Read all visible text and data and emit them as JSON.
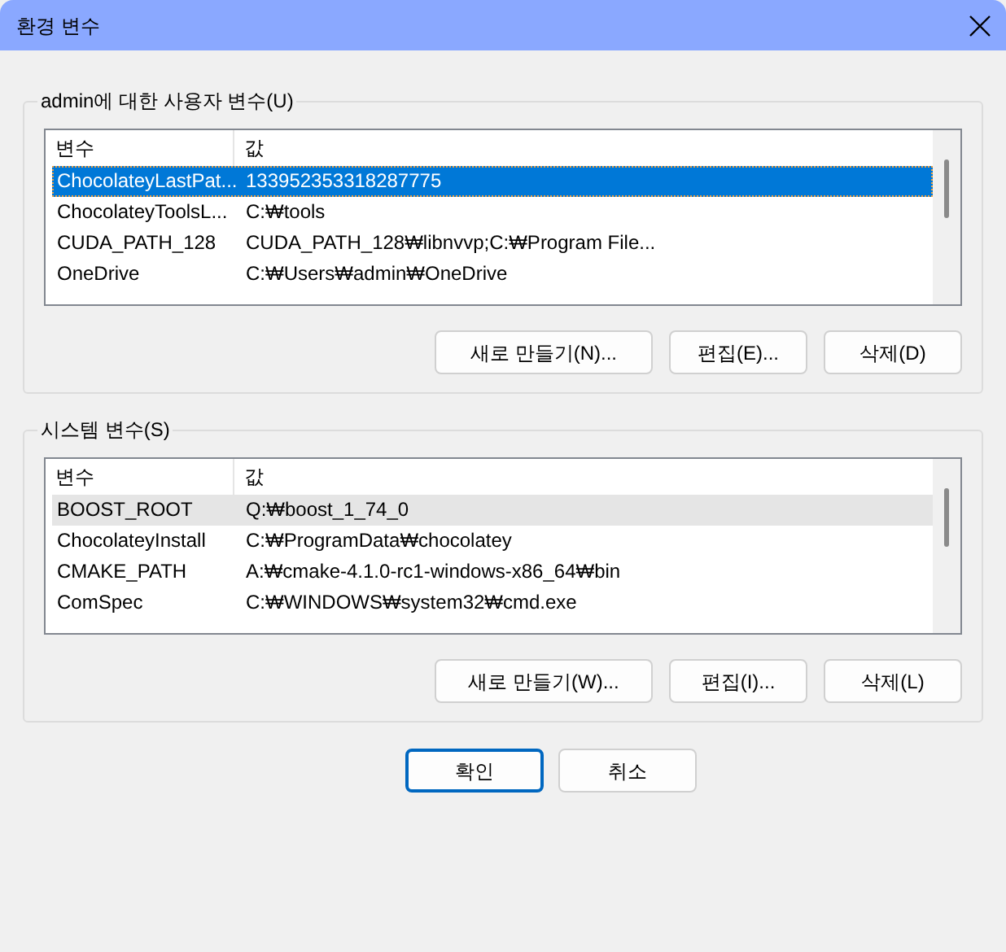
{
  "window": {
    "title": "환경 변수"
  },
  "groups": [
    {
      "title": "admin에 대한 사용자 변수(U)",
      "focused": true,
      "columns": [
        "변수",
        "값"
      ],
      "rows": [
        {
          "name": "ChocolateyLastPat...",
          "value": "133952353318287775",
          "selected": true
        },
        {
          "name": "ChocolateyToolsL...",
          "value": "C:₩tools",
          "selected": false
        },
        {
          "name": "CUDA_PATH_128",
          "value": "CUDA_PATH_128₩libnvvp;C:₩Program File...",
          "selected": false
        },
        {
          "name": "OneDrive",
          "value": "C:₩Users₩admin₩OneDrive",
          "selected": false
        }
      ],
      "buttons": [
        "새로 만들기(N)...",
        "편집(E)...",
        "삭제(D)"
      ]
    },
    {
      "title": "시스템 변수(S)",
      "focused": false,
      "columns": [
        "변수",
        "값"
      ],
      "rows": [
        {
          "name": "BOOST_ROOT",
          "value": "Q:₩boost_1_74_0",
          "selected": true
        },
        {
          "name": "ChocolateyInstall",
          "value": "C:₩ProgramData₩chocolatey",
          "selected": false
        },
        {
          "name": "CMAKE_PATH",
          "value": "A:₩cmake-4.1.0-rc1-windows-x86_64₩bin",
          "selected": false
        },
        {
          "name": "ComSpec",
          "value": "C:₩WINDOWS₩system32₩cmd.exe",
          "selected": false
        }
      ],
      "buttons": [
        "새로 만들기(W)...",
        "편집(I)...",
        "삭제(L)"
      ]
    }
  ],
  "buttons": [
    {
      "label": "확인",
      "default": true
    },
    {
      "label": "취소",
      "default": false
    }
  ]
}
